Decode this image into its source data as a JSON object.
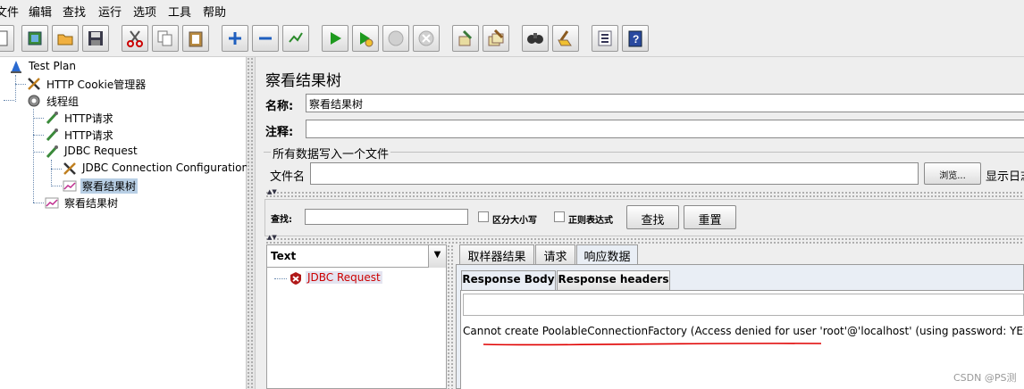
{
  "menu": [
    "文件",
    "编辑",
    "查找",
    "运行",
    "选项",
    "工具",
    "帮助"
  ],
  "toolbar": {
    "icons": [
      "new-icon",
      "templates-icon",
      "open-icon",
      "save-icon",
      "cut-icon",
      "copy-icon",
      "paste-icon",
      "expand-icon",
      "collapse-icon",
      "toggle-icon",
      "start-icon",
      "start-no-pause-icon",
      "stop-icon",
      "shutdown-icon",
      "clear-icon",
      "clear-all-icon",
      "search-icon",
      "reset-search-icon",
      "function-helper-icon",
      "help-icon"
    ]
  },
  "tree": {
    "nodes": [
      {
        "label": "Test Plan",
        "icon": "test-plan-icon"
      },
      {
        "label": "HTTP Cookie管理器",
        "icon": "tools-icon"
      },
      {
        "label": "线程组",
        "icon": "gear-icon"
      },
      {
        "label": "HTTP请求",
        "icon": "pipette-icon"
      },
      {
        "label": "HTTP请求",
        "icon": "pipette-icon"
      },
      {
        "label": "JDBC Request",
        "icon": "pipette-icon"
      },
      {
        "label": "JDBC Connection Configuration",
        "icon": "tools-icon"
      },
      {
        "label": "察看结果树",
        "icon": "graph-icon"
      },
      {
        "label": "察看结果树",
        "icon": "graph-icon"
      }
    ]
  },
  "panel": {
    "title": "察看结果树",
    "name_label": "名称:",
    "name_value": "察看结果树",
    "comment_label": "注释:",
    "comment_value": "",
    "file_group_title": "所有数据写入一个文件",
    "filename_label": "文件名",
    "filename_value": "",
    "browse_label": "浏览...",
    "log_display_label": "显示日志"
  },
  "search": {
    "label": "查找:",
    "value": "",
    "case_label": "区分大小写",
    "regex_label": "正则表达式",
    "find_label": "查找",
    "reset_label": "重置"
  },
  "results": {
    "renderer": "Text",
    "items": [
      {
        "label": "JDBC Request",
        "status": "error"
      }
    ],
    "tabs": [
      "取样器结果",
      "请求",
      "响应数据"
    ],
    "subtabs": [
      "Response Body",
      "Response headers"
    ],
    "response_text": "Cannot create PoolableConnectionFactory (Access denied for user 'root'@'localhost' (using password: YES))"
  },
  "watermark": "CSDN @PS测",
  "colors": {
    "selection": "#b8cfe5",
    "error_text": "#cc0000",
    "annotation": "#e00000"
  }
}
